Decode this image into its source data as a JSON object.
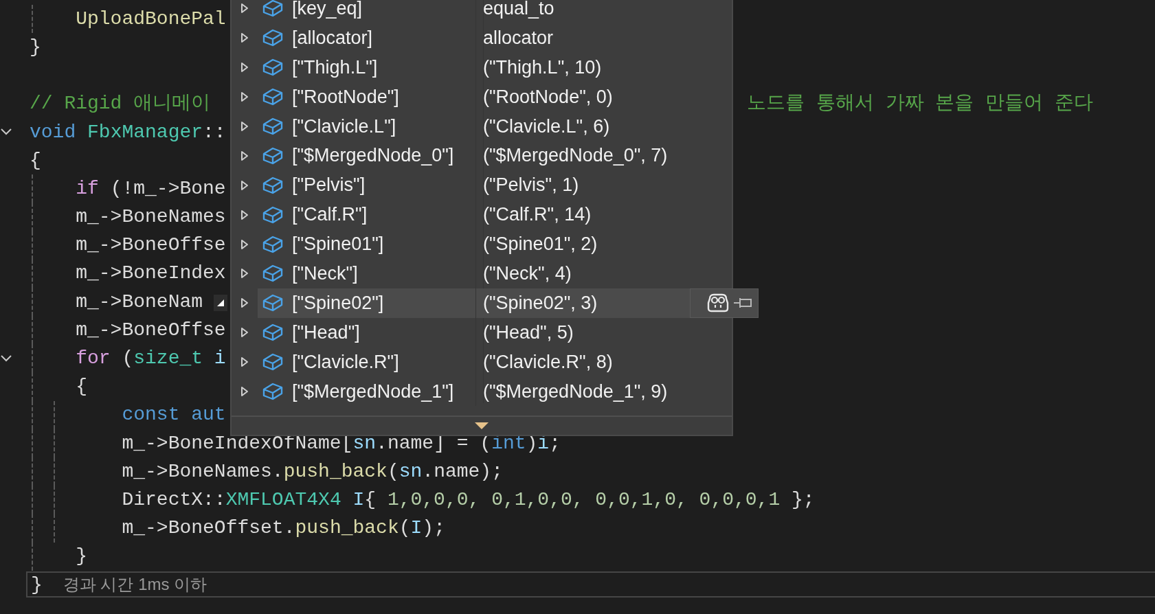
{
  "editor": {
    "lines": [
      {
        "fold": false,
        "segments": [
          {
            "text": "    UploadBonePal",
            "kind": "func"
          }
        ]
      },
      {
        "fold": false,
        "segments": [
          {
            "text": "}",
            "kind": "plain"
          }
        ]
      },
      {
        "fold": false
      },
      {
        "fold": false,
        "segments": [
          {
            "text": "// Rigid 애니메이",
            "kind": "comment"
          }
        ],
        "tail": [
          {
            "text": "노드를 통해서 가짜 본을 만들어 준다",
            "kind": "comment"
          }
        ]
      },
      {
        "fold": true,
        "segments": [
          {
            "text": "void",
            "kind": "keyword"
          },
          {
            "text": " FbxManager",
            "kind": "type"
          },
          {
            "text": "::",
            "kind": "plain"
          }
        ]
      },
      {
        "fold": false,
        "segments": [
          {
            "text": "{",
            "kind": "plain"
          }
        ]
      },
      {
        "fold": false,
        "segments": [
          {
            "text": "    if",
            "kind": "control"
          },
          {
            "text": " (!m_->Bone",
            "kind": "plain"
          }
        ]
      },
      {
        "fold": false,
        "segments": [
          {
            "text": "    m_->BoneNames",
            "kind": "plain"
          }
        ]
      },
      {
        "fold": false,
        "segments": [
          {
            "text": "    m_->BoneOffse",
            "kind": "plain"
          }
        ]
      },
      {
        "fold": false,
        "segments": [
          {
            "text": "    m_->BoneIndex",
            "kind": "plain"
          }
        ]
      },
      {
        "fold": false,
        "segments": [
          {
            "text": "    m_->BoneNam",
            "kind": "plain"
          }
        ]
      },
      {
        "fold": false,
        "segments": [
          {
            "text": "    m_->BoneOffse",
            "kind": "plain"
          }
        ]
      },
      {
        "fold": true,
        "segments": [
          {
            "text": "    for",
            "kind": "control"
          },
          {
            "text": " (",
            "kind": "plain"
          },
          {
            "text": "size_t",
            "kind": "type"
          },
          {
            "text": " i",
            "kind": "var"
          }
        ]
      },
      {
        "fold": false,
        "segments": [
          {
            "text": "    {",
            "kind": "plain"
          }
        ]
      },
      {
        "fold": false,
        "segments": [
          {
            "text": "        const",
            "kind": "keyword"
          },
          {
            "text": " aut",
            "kind": "keyword"
          }
        ]
      },
      {
        "fold": false,
        "segments": [
          {
            "text": "        m_->BoneIndexOfName[",
            "kind": "plain"
          },
          {
            "text": "sn",
            "kind": "var"
          },
          {
            "text": ".name] = (",
            "kind": "plain"
          },
          {
            "text": "int",
            "kind": "keyword"
          },
          {
            "text": ")",
            "kind": "plain"
          },
          {
            "text": "i",
            "kind": "var"
          },
          {
            "text": ";",
            "kind": "plain"
          }
        ]
      },
      {
        "fold": false,
        "segments": [
          {
            "text": "        m_->BoneNames.",
            "kind": "plain"
          },
          {
            "text": "push_back",
            "kind": "func"
          },
          {
            "text": "(",
            "kind": "plain"
          },
          {
            "text": "sn",
            "kind": "var"
          },
          {
            "text": ".name);",
            "kind": "plain"
          }
        ]
      },
      {
        "fold": false,
        "segments": [
          {
            "text": "        DirectX::",
            "kind": "plain"
          },
          {
            "text": "XMFLOAT4X4",
            "kind": "type"
          },
          {
            "text": " I",
            "kind": "var"
          },
          {
            "text": "{ ",
            "kind": "plain"
          },
          {
            "text": "1,0,0,0, 0,1,0,0, 0,0,1,0, 0,0,0,1",
            "kind": "num"
          },
          {
            "text": " };",
            "kind": "plain"
          }
        ]
      },
      {
        "fold": false,
        "segments": [
          {
            "text": "        m_->BoneOffset.",
            "kind": "plain"
          },
          {
            "text": "push_back",
            "kind": "func"
          },
          {
            "text": "(",
            "kind": "plain"
          },
          {
            "text": "I",
            "kind": "var"
          },
          {
            "text": ");",
            "kind": "plain"
          }
        ]
      },
      {
        "fold": false,
        "segments": [
          {
            "text": "    }",
            "kind": "plain"
          }
        ]
      }
    ],
    "current_line": {
      "brace": "}",
      "hint": "경과 시간 1ms 이하"
    }
  },
  "datatip": {
    "rows": [
      {
        "name": "[key_eq]",
        "value": "equal_to",
        "selected": false
      },
      {
        "name": "[allocator]",
        "value": "allocator",
        "selected": false
      },
      {
        "name": "[\"Thigh.L\"]",
        "value": "(\"Thigh.L\", 10)",
        "selected": false
      },
      {
        "name": "[\"RootNode\"]",
        "value": "(\"RootNode\", 0)",
        "selected": false
      },
      {
        "name": "[\"Clavicle.L\"]",
        "value": "(\"Clavicle.L\", 6)",
        "selected": false
      },
      {
        "name": "[\"$MergedNode_0\"]",
        "value": "(\"$MergedNode_0\", 7)",
        "selected": false
      },
      {
        "name": "[\"Pelvis\"]",
        "value": "(\"Pelvis\", 1)",
        "selected": false
      },
      {
        "name": "[\"Calf.R\"]",
        "value": "(\"Calf.R\", 14)",
        "selected": false
      },
      {
        "name": "[\"Spine01\"]",
        "value": "(\"Spine01\", 2)",
        "selected": false
      },
      {
        "name": "[\"Neck\"]",
        "value": "(\"Neck\", 4)",
        "selected": false
      },
      {
        "name": "[\"Spine02\"]",
        "value": "(\"Spine02\", 3)",
        "selected": true
      },
      {
        "name": "[\"Head\"]",
        "value": "(\"Head\", 5)",
        "selected": false
      },
      {
        "name": "[\"Clavicle.R\"]",
        "value": "(\"Clavicle.R\", 8)",
        "selected": false
      },
      {
        "name": "[\"$MergedNode_1\"]",
        "value": "(\"$MergedNode_1\", 9)",
        "selected": false
      }
    ]
  }
}
